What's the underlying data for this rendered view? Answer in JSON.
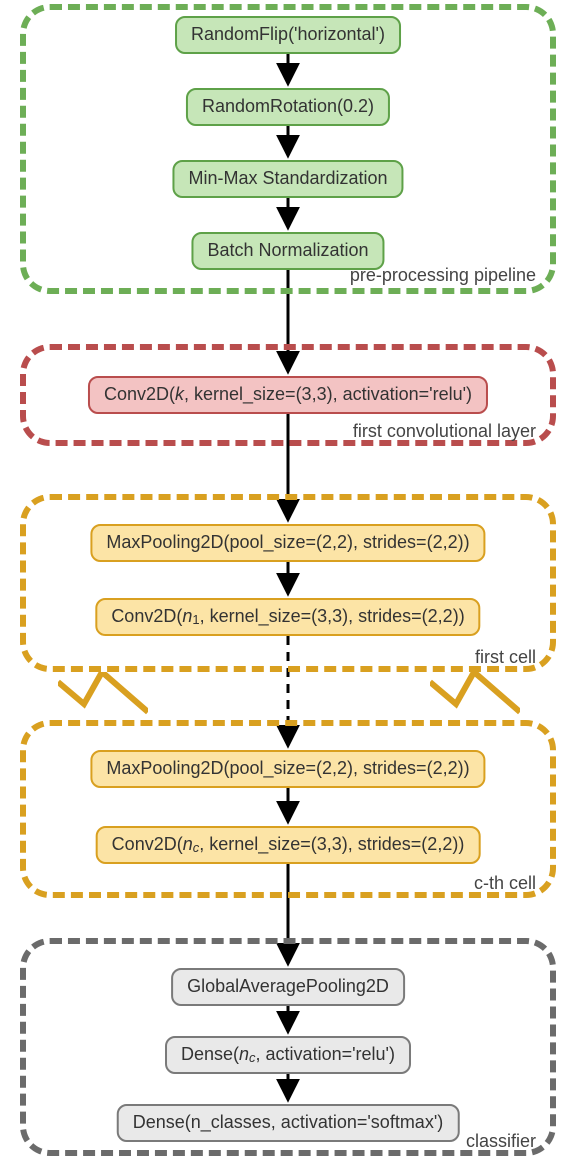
{
  "groups": {
    "preprocessing": {
      "label": "pre-processing pipeline"
    },
    "firstconv": {
      "label": "first convolutional layer"
    },
    "firstcell": {
      "label": "first cell"
    },
    "cthcell": {
      "label": "c-th cell"
    },
    "classifier": {
      "label": "classifier"
    }
  },
  "nodes": {
    "randomflip": "RandomFlip('horizontal')",
    "randomrot": "RandomRotation(0.2)",
    "minmax": "Min-Max Standardization",
    "batchnorm": "Batch Normalization",
    "conv_k_pre": "Conv2D(",
    "conv_k_var": "k",
    "conv_k_post": ", kernel_size=(3,3), activation='relu')",
    "maxpool1": "MaxPooling2D(pool_size=(2,2), strides=(2,2))",
    "conv_n1_pre": "Conv2D(",
    "conv_n1_var": "n",
    "conv_n1_sub": "1",
    "conv_n1_post": ", kernel_size=(3,3), strides=(2,2))",
    "maxpoolc": "MaxPooling2D(pool_size=(2,2), strides=(2,2))",
    "conv_nc_pre": "Conv2D(",
    "conv_nc_var": "n",
    "conv_nc_sub": "c",
    "conv_nc_post": ", kernel_size=(3,3), strides=(2,2))",
    "gap": "GlobalAveragePooling2D",
    "dense1_pre": "Dense(",
    "dense1_var": "n",
    "dense1_sub": "c",
    "dense1_post": ", activation='relu')",
    "dense2": "Dense(n_classes, activation='softmax')"
  }
}
